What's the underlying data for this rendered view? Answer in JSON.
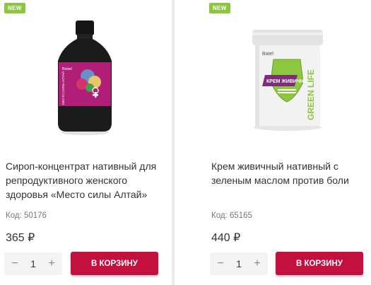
{
  "products": [
    {
      "badge": "NEW",
      "name": "Сироп-концентрат нативный для репродуктивного женского здоровья «Место силы Алтай»",
      "code": "Код: 50176",
      "price": "365 ₽",
      "quantity": "1",
      "minus": "−",
      "plus": "+",
      "cart_label": "В КОРЗИНУ",
      "image_icon": "syrup-bottle-icon",
      "label_brand": "Biotel",
      "bottle_side_text": "МЕСТО СИЛЫ АЛТАЙ"
    },
    {
      "badge": "NEW",
      "name": "Крем живичный нативный с зеленым маслом против боли",
      "code": "Код: 65165",
      "price": "440 ₽",
      "quantity": "1",
      "minus": "−",
      "plus": "+",
      "cart_label": "В КОРЗИНУ",
      "image_icon": "cream-jar-icon",
      "label_brand": "Batel",
      "label_title": "КРЕМ ЖИВИЧНЫЙ",
      "label_side": "GREEN LIFE"
    }
  ],
  "colors": {
    "badge": "#8cc63f",
    "cart_button": "#c4103f",
    "background": "#eaeaea"
  }
}
